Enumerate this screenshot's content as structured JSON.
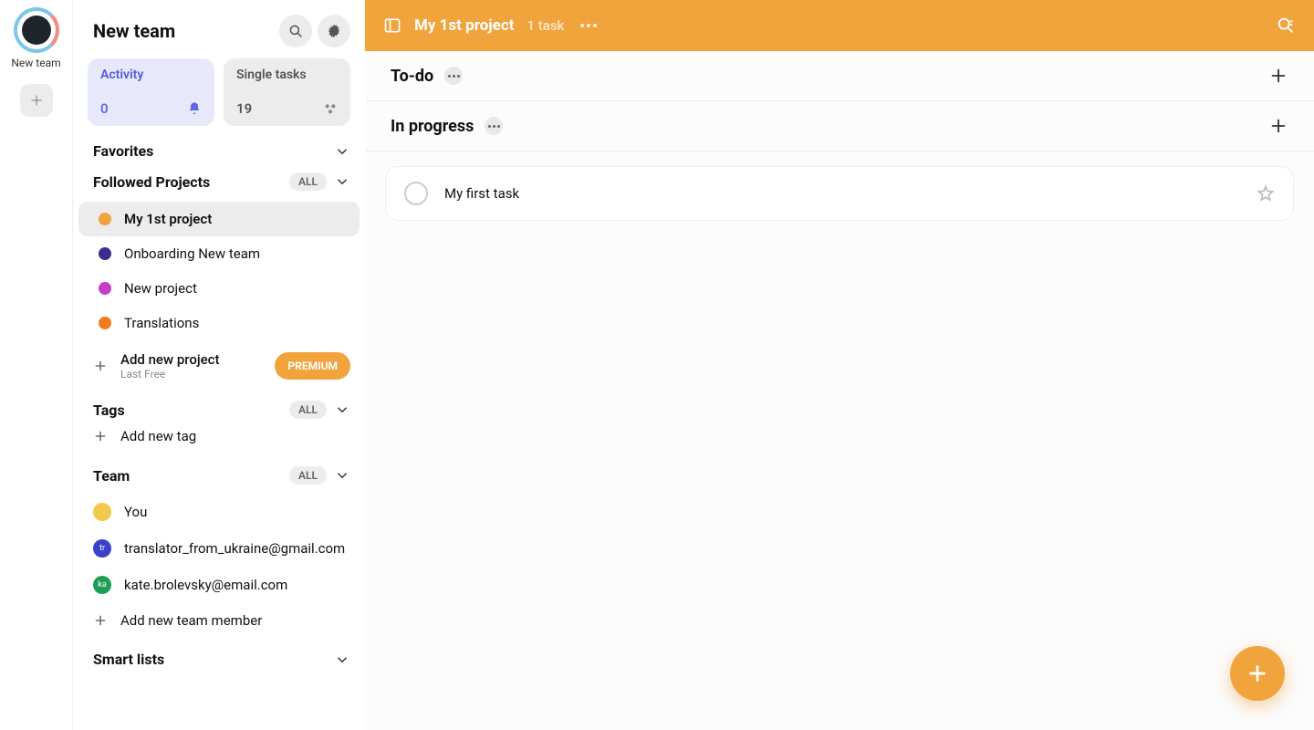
{
  "workspace": {
    "name": "New team"
  },
  "sidebar": {
    "title": "New team",
    "activity": {
      "label": "Activity",
      "count": "0"
    },
    "single_tasks": {
      "label": "Single tasks",
      "count": "19"
    },
    "favorites_label": "Favorites",
    "followed_label": "Followed Projects",
    "all_pill": "ALL",
    "projects": [
      {
        "name": "My 1st project",
        "color": "#f1a33c",
        "active": true
      },
      {
        "name": "Onboarding New team",
        "color": "#3a2f8f",
        "active": false
      },
      {
        "name": "New project",
        "color": "#c53dc9",
        "active": false
      },
      {
        "name": "Translations",
        "color": "#f07b1f",
        "active": false
      }
    ],
    "add_project": {
      "title": "Add new project",
      "sub": "Last Free",
      "premium": "PREMIUM"
    },
    "tags_label": "Tags",
    "add_tag": "Add new tag",
    "team_label": "Team",
    "team": [
      {
        "name": "You",
        "color": "#f2c94c",
        "initials": ""
      },
      {
        "name": "translator_from_ukraine@gmail.com",
        "color": "#3a42c9",
        "initials": "tr"
      },
      {
        "name": "kate.brolevsky@email.com",
        "color": "#1f9d55",
        "initials": "ka"
      }
    ],
    "add_member": "Add new team member",
    "smart_lists_label": "Smart lists"
  },
  "main": {
    "title": "My 1st project",
    "subtitle": "1 task",
    "groups": [
      {
        "name": "To-do",
        "tasks": []
      },
      {
        "name": "In progress",
        "tasks": [
          {
            "title": "My first task"
          }
        ]
      }
    ]
  }
}
